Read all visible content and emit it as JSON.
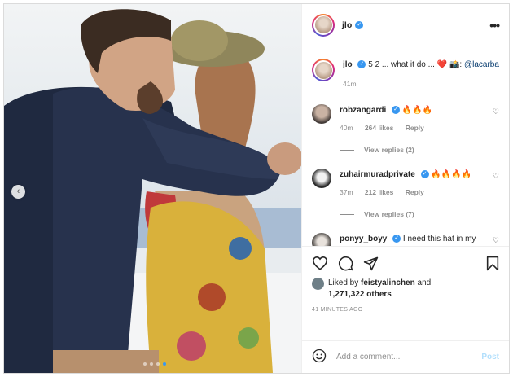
{
  "post": {
    "username": "jlo",
    "caption_text": "5 2 ... what it do ...",
    "caption_emoji_1": "❤️",
    "caption_emoji_2": "📸",
    "caption_colon": ":",
    "caption_mention": "@lacarba",
    "caption_time": "41m",
    "liked_by_prefix": "Liked by",
    "liked_by_user": "feistyalinchen",
    "liked_by_and": "and",
    "liked_by_count": "1,271,322 others",
    "timestamp": "41 MINUTES AGO",
    "carousel_dots": 4,
    "carousel_active_index": 3
  },
  "comments": [
    {
      "username": "robzangardi",
      "text": "🔥🔥🔥",
      "time": "40m",
      "likes": "264 likes",
      "reply": "Reply",
      "view_replies": "View replies (2)"
    },
    {
      "username": "zuhairmuradprivate",
      "text": "🔥🔥🔥🔥",
      "time": "37m",
      "likes": "212 likes",
      "reply": "Reply",
      "view_replies": "View replies (7)"
    },
    {
      "username": "ponyy_boyy",
      "text": "I need this hat in my life! 😍🙌"
    }
  ],
  "composer": {
    "placeholder": "Add a comment...",
    "post_label": "Post"
  },
  "icons": [
    "more-options-icon",
    "heart-icon",
    "comment-icon",
    "share-icon",
    "save-icon",
    "emoji-icon",
    "verified-icon",
    "carousel-arrow-icon"
  ],
  "colors": {
    "accent": "#3897f0",
    "post_disabled": "#b2dffc",
    "muted": "#8e8e8e"
  }
}
